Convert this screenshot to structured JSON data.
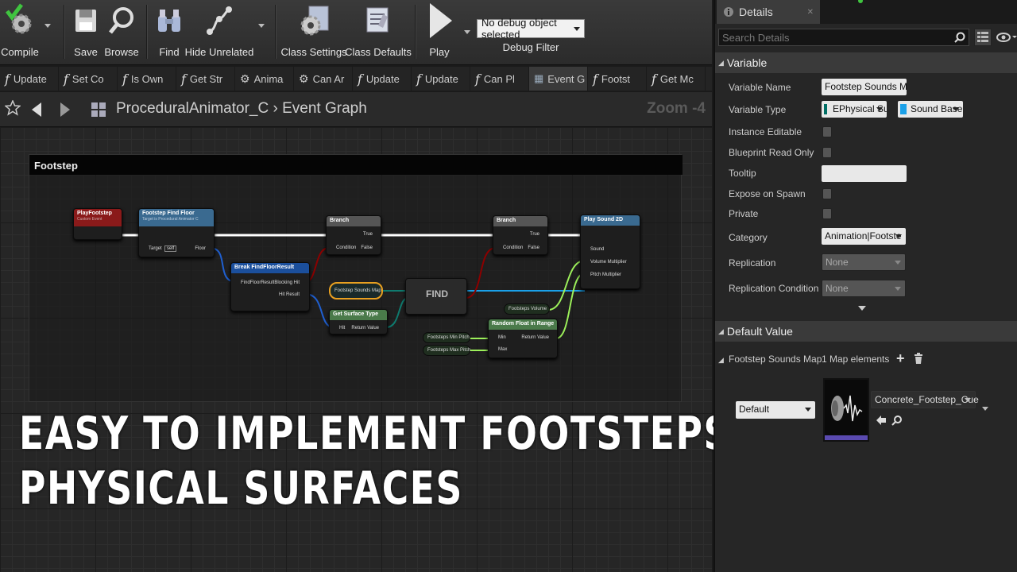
{
  "toolbar": {
    "compile": "Compile",
    "save": "Save",
    "browse": "Browse",
    "find": "Find",
    "hide_unrelated": "Hide Unrelated",
    "class_settings": "Class Settings",
    "class_defaults": "Class Defaults",
    "play": "Play",
    "debug_object": "No debug object selected",
    "debug_filter": "Debug Filter"
  },
  "tabs": [
    {
      "label": "Update",
      "icon": "function-icon"
    },
    {
      "label": "Set Co",
      "icon": "function-icon"
    },
    {
      "label": "Is Own",
      "icon": "function-icon"
    },
    {
      "label": "Get Str",
      "icon": "function-icon"
    },
    {
      "label": "Anima",
      "icon": "gear-icon"
    },
    {
      "label": "Can Ar",
      "icon": "gear-icon"
    },
    {
      "label": "Update",
      "icon": "function-icon"
    },
    {
      "label": "Update",
      "icon": "function-icon"
    },
    {
      "label": "Can Pl",
      "icon": "function-icon"
    },
    {
      "label": "Event G",
      "icon": "graph-icon"
    },
    {
      "label": "Footst",
      "icon": "function-icon"
    },
    {
      "label": "Get Mc",
      "icon": "function-icon"
    }
  ],
  "breadcrumb": {
    "class": "ProceduralAnimator_C",
    "separator": "›",
    "graph": "Event Graph",
    "zoom": "Zoom -4"
  },
  "graph": {
    "comment": "Footstep",
    "nodes": {
      "play_footstep": {
        "title": "PlayFootstep",
        "sub": "Custom Event"
      },
      "find_floor": {
        "title": "Footstep Find Floor",
        "sub": "Target is Procedural Animator C",
        "target": "Target",
        "target_val": "self",
        "out": "Floor"
      },
      "break_hit": {
        "title": "Break FindFloorResult",
        "in": "FindFloorResult",
        "out1": "Blocking Hit",
        "out2": "Hit Result"
      },
      "branch1": {
        "title": "Branch",
        "cond": "Condition",
        "t": "True",
        "f": "False"
      },
      "branch2": {
        "title": "Branch",
        "cond": "Condition",
        "t": "True",
        "f": "False"
      },
      "sounds_map": {
        "title": "Footstep Sounds Map"
      },
      "find": {
        "title": "FIND"
      },
      "surface": {
        "title": "Get Surface Type",
        "in": "Hit",
        "out": "Return Value"
      },
      "play_sound": {
        "title": "Play Sound 2D",
        "p1": "Sound",
        "p2": "Volume Multiplier",
        "p3": "Pitch Multiplier"
      },
      "volume": {
        "title": "Footsteps Volume"
      },
      "random": {
        "title": "Random Float in Range",
        "min": "Min",
        "max": "Max",
        "ret": "Return Value"
      },
      "min_pitch": {
        "title": "Footsteps Min Pitch"
      },
      "max_pitch": {
        "title": "Footsteps Max Pitch"
      }
    }
  },
  "overlay_text": {
    "line1": "EASY TO IMPLEMENT FOOTSTEPS USING",
    "line2": "PHYSICAL SURFACES"
  },
  "details": {
    "tab": "Details",
    "search_placeholder": "Search Details",
    "variable_section": "Variable",
    "props": {
      "variable_name": "Variable Name",
      "variable_name_val": "Footstep Sounds Map",
      "variable_type": "Variable Type",
      "type_key": "EPhysical Su",
      "type_value": "Sound Base",
      "instance_editable": "Instance Editable",
      "blueprint_read_only": "Blueprint Read Only",
      "tooltip": "Tooltip",
      "expose_on_spawn": "Expose on Spawn",
      "private": "Private",
      "category": "Category",
      "category_val": "Animation|Footste",
      "replication": "Replication",
      "replication_val": "None",
      "replication_condition": "Replication Condition",
      "replication_condition_val": "None"
    },
    "default_section": "Default Value",
    "default": {
      "map_name": "Footstep Sounds Map",
      "count": "1 Map elements",
      "key": "Default",
      "asset": "Concrete_Footstep_Cue"
    }
  },
  "colors": {
    "exec": "#ffffff",
    "bool": "#8c0000",
    "struct": "#0057c8",
    "float": "#9cf05a",
    "object": "#00a8f0",
    "byte": "#006f65"
  }
}
